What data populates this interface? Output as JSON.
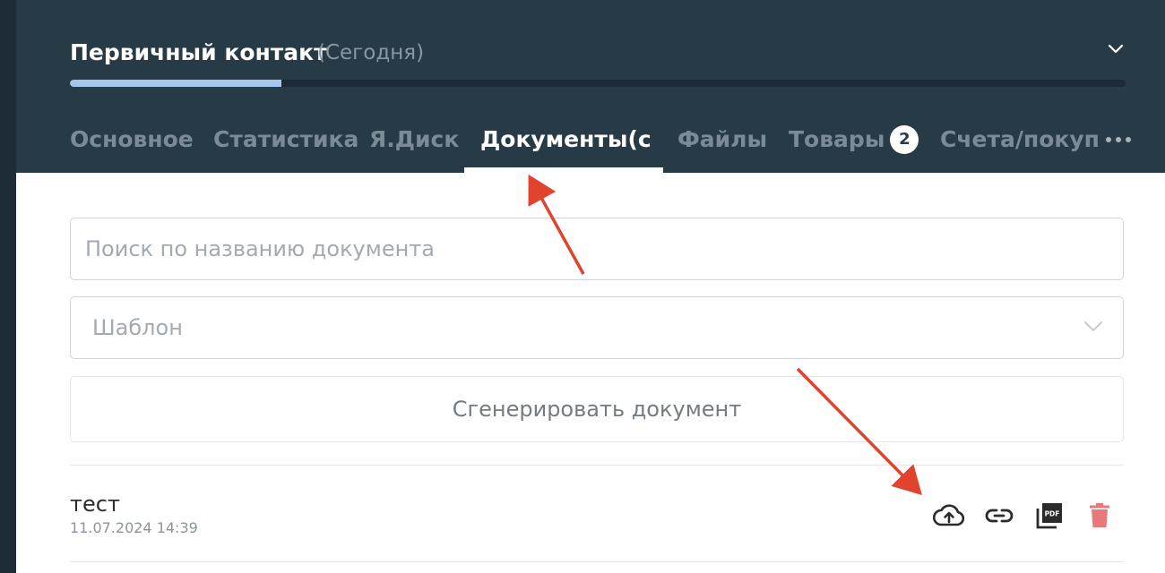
{
  "header": {
    "title": "Первичный контакт",
    "subtitle": "(Сегодня)",
    "progress_fraction": 0.2
  },
  "tabs": [
    {
      "label": "Основное"
    },
    {
      "label": "Статистика"
    },
    {
      "label": "Я.Диск"
    },
    {
      "label": "Документы(сч",
      "active": true
    },
    {
      "label": "Файлы"
    },
    {
      "label": "Товары",
      "badge": "2"
    },
    {
      "label": "Счета/покуп"
    }
  ],
  "search": {
    "placeholder": "Поиск по названию документа",
    "value": ""
  },
  "template_select": {
    "placeholder": "Шаблон"
  },
  "generate_button": {
    "label": "Сгенерировать документ"
  },
  "documents": [
    {
      "name": "тест",
      "date": "11.07.2024 14:39"
    }
  ],
  "colors": {
    "header_bg": "#273b47",
    "progress_fill": "#a5c6ef",
    "annotation_arrow": "#e0432e",
    "delete_icon": "#e8797a"
  },
  "icons": {
    "collapse": "chevron-down-icon",
    "more": "more-horizontal-icon",
    "upload": "cloud-upload-icon",
    "link": "link-icon",
    "pdf": "pdf-icon",
    "delete": "trash-icon"
  }
}
